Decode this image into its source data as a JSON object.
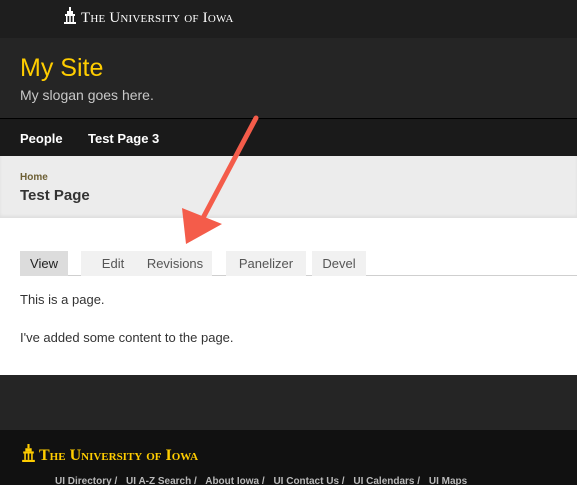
{
  "university": {
    "name": "The University of Iowa"
  },
  "site": {
    "name": "My Site",
    "slogan": "My slogan goes here."
  },
  "nav": {
    "items": [
      "People",
      "Test Page 3"
    ]
  },
  "breadcrumb": {
    "home": "Home"
  },
  "page": {
    "title": "Test Page"
  },
  "tabs": {
    "view": "View",
    "edit": "Edit",
    "revisions": "Revisions",
    "panelizer": "Panelizer",
    "devel": "Devel"
  },
  "content": {
    "paragraph1": "This is a page.",
    "paragraph2": "I've added some content to the page."
  },
  "footer": {
    "name": "The University of Iowa",
    "links": [
      "UI Directory /",
      "UI A-Z Search /",
      "About Iowa /",
      "UI Contact Us /",
      "UI Calendars /",
      "UI Maps"
    ]
  },
  "colors": {
    "gold": "#ffcd00",
    "annotation_arrow": "#f45c4a"
  },
  "icons": {
    "university_logo": "old-capitol-icon",
    "annotation": "red-arrow-icon"
  }
}
